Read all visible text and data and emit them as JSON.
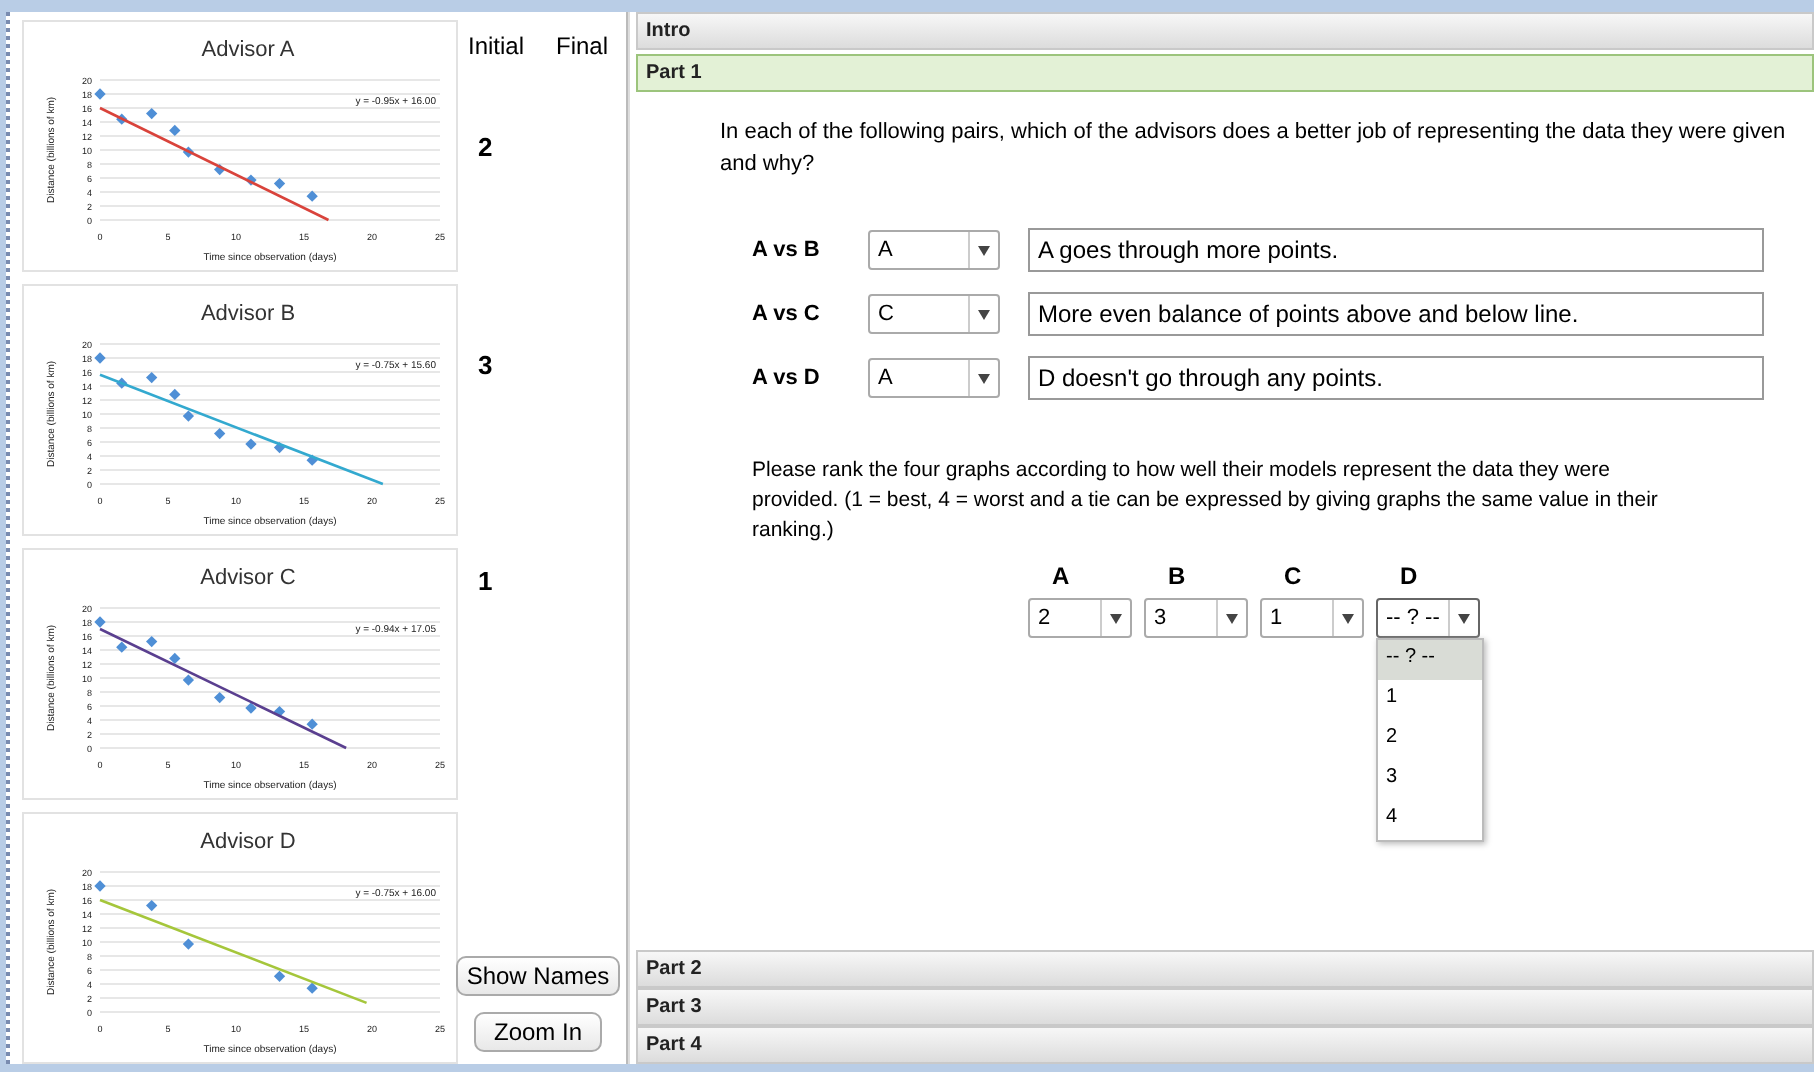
{
  "charts": [
    {
      "initial": "2",
      "chart_data": {
        "type": "scatter",
        "title": "Advisor A",
        "xlabel": "Time since observation (days)",
        "ylabel": "Distance (billions of km)",
        "xlim": [
          0,
          25
        ],
        "ylim": [
          0,
          20
        ],
        "xticks": [
          0,
          5,
          10,
          15,
          20,
          25
        ],
        "yticks": [
          0,
          2,
          4,
          6,
          8,
          10,
          12,
          14,
          16,
          18,
          20
        ],
        "grid": true,
        "annotations": [
          "y = -0.95x + 16.00"
        ],
        "series": [
          {
            "type": "scatter",
            "color": "#4f8fd6",
            "x": [
              0,
              1.6,
              3.8,
              5.5,
              6.5,
              8.8,
              11.1,
              13.2,
              15.6
            ],
            "values": [
              18,
              14.4,
              15.2,
              12.8,
              9.7,
              7.2,
              5.7,
              5.2,
              3.4
            ]
          },
          {
            "type": "line",
            "color": "#d9433b",
            "x": [
              0,
              16.8
            ],
            "values": [
              16,
              0
            ]
          }
        ]
      }
    },
    {
      "initial": "3",
      "chart_data": {
        "type": "scatter",
        "title": "Advisor B",
        "xlabel": "Time since observation (days)",
        "ylabel": "Distance (billions of km)",
        "xlim": [
          0,
          25
        ],
        "ylim": [
          0,
          20
        ],
        "xticks": [
          0,
          5,
          10,
          15,
          20,
          25
        ],
        "yticks": [
          0,
          2,
          4,
          6,
          8,
          10,
          12,
          14,
          16,
          18,
          20
        ],
        "grid": true,
        "annotations": [
          "y = -0.75x + 15.60"
        ],
        "series": [
          {
            "type": "scatter",
            "color": "#4f8fd6",
            "x": [
              0,
              1.6,
              3.8,
              5.5,
              6.5,
              8.8,
              11.1,
              13.2,
              15.6
            ],
            "values": [
              18,
              14.4,
              15.2,
              12.8,
              9.7,
              7.2,
              5.7,
              5.2,
              3.4
            ]
          },
          {
            "type": "line",
            "color": "#33a9cf",
            "x": [
              0,
              20.8
            ],
            "values": [
              15.6,
              0
            ]
          }
        ]
      }
    },
    {
      "initial": "1",
      "chart_data": {
        "type": "scatter",
        "title": "Advisor C",
        "xlabel": "Time since observation (days)",
        "ylabel": "Distance (billions of km)",
        "xlim": [
          0,
          25
        ],
        "ylim": [
          0,
          20
        ],
        "xticks": [
          0,
          5,
          10,
          15,
          20,
          25
        ],
        "yticks": [
          0,
          2,
          4,
          6,
          8,
          10,
          12,
          14,
          16,
          18,
          20
        ],
        "grid": true,
        "annotations": [
          "y = -0.94x + 17.05"
        ],
        "series": [
          {
            "type": "scatter",
            "color": "#4f8fd6",
            "x": [
              0,
              1.6,
              3.8,
              5.5,
              6.5,
              8.8,
              11.1,
              13.2,
              15.6
            ],
            "values": [
              18,
              14.4,
              15.2,
              12.8,
              9.7,
              7.2,
              5.7,
              5.2,
              3.4
            ]
          },
          {
            "type": "line",
            "color": "#5a3f8f",
            "x": [
              0,
              18.1
            ],
            "values": [
              17,
              0
            ]
          }
        ]
      }
    },
    {
      "chart_data": {
        "type": "scatter",
        "title": "Advisor D",
        "xlabel": "Time since observation (days)",
        "ylabel": "Distance (billions of km)",
        "xlim": [
          0,
          25
        ],
        "ylim": [
          0,
          20
        ],
        "xticks": [
          0,
          5,
          10,
          15,
          20,
          25
        ],
        "yticks": [
          0,
          2,
          4,
          6,
          8,
          10,
          12,
          14,
          16,
          18,
          20
        ],
        "grid": true,
        "annotations": [
          "y = -0.75x + 16.00"
        ],
        "series": [
          {
            "type": "scatter",
            "color": "#4f8fd6",
            "x": [
              0,
              3.8,
              6.5,
              13.2,
              15.6
            ],
            "values": [
              18,
              15.2,
              9.7,
              5.1,
              3.4
            ]
          },
          {
            "type": "line",
            "color": "#a5c63b",
            "x": [
              0,
              19.6
            ],
            "values": [
              16,
              1.3
            ]
          }
        ]
      }
    }
  ],
  "columns": [
    "Initial",
    "Final"
  ],
  "buttons": [
    "Show Names",
    "Zoom In"
  ],
  "sections": [
    {
      "label": "Intro",
      "selected": false
    },
    {
      "label": "Part 1",
      "selected": true
    }
  ],
  "question": "In each of the following pairs, which of the advisors does a better job of representing the data they were given and why?",
  "comparisons": [
    {
      "label": "A vs B",
      "choice": "A",
      "answer": "A goes through more points."
    },
    {
      "label": "A vs C",
      "choice": "C",
      "answer": "More even balance of points above and below line."
    },
    {
      "label": "A vs D",
      "choice": "A",
      "answer": "D doesn't go through any points."
    }
  ],
  "ranking": {
    "prompt": "Please rank the four graphs according to how well their models represent the data they were provided. (1 = best, 4 = worst and a tie can be expressed by giving graphs the same value in their ranking.)",
    "items": [
      {
        "label": "A",
        "value": "2",
        "expanded": false
      },
      {
        "label": "B",
        "value": "3",
        "expanded": false
      },
      {
        "label": "C",
        "value": "1",
        "expanded": false
      },
      {
        "label": "D",
        "value": "-- ? --",
        "expanded": true,
        "options": [
          {
            "label": "-- ? --",
            "selected": true
          },
          {
            "label": "1",
            "selected": false
          },
          {
            "label": "2",
            "selected": false
          },
          {
            "label": "3",
            "selected": false
          },
          {
            "label": "4",
            "selected": false
          }
        ]
      }
    ]
  },
  "lower_sections": [
    {
      "label": "Part 2"
    },
    {
      "label": "Part 3"
    },
    {
      "label": "Part 4"
    }
  ]
}
